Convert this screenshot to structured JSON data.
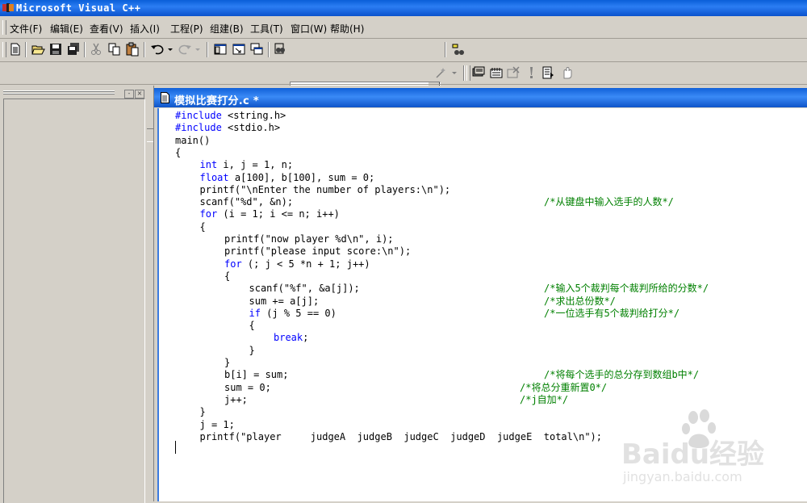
{
  "window": {
    "title": "Microsoft Visual C++"
  },
  "menu": [
    {
      "label": "文件(F)"
    },
    {
      "label": "编辑(E)"
    },
    {
      "label": "查看(V)"
    },
    {
      "label": "插入(I)"
    },
    {
      "label": "工程(P)"
    },
    {
      "label": "组建(B)"
    },
    {
      "label": "工具(T)"
    },
    {
      "label": "窗口(W)"
    },
    {
      "label": "帮助(H)"
    }
  ],
  "toolbar": {
    "find_combo_value": "",
    "icons": [
      "new-file-icon",
      "open-icon",
      "save-icon",
      "save-all-icon",
      "cut-icon",
      "copy-icon",
      "paste-icon",
      "undo-icon",
      "redo-icon",
      "workspace-icon",
      "output-icon",
      "window-list-icon",
      "find-in-files-icon",
      "find-icon"
    ]
  },
  "wizardbar": {
    "class_combo": "",
    "filter_combo": "",
    "members_combo": "",
    "icons": [
      "wizard-action-icon",
      "compile-icon",
      "build-icon",
      "stop-build-icon",
      "execute-icon",
      "go-icon",
      "insert-breakpoint-icon"
    ]
  },
  "editor": {
    "tab_title": "模拟比赛打分.c *",
    "lines": [
      {
        "indent": 0,
        "parts": [
          {
            "t": "#include",
            "k": "kw"
          },
          {
            "t": " <string.h>"
          }
        ]
      },
      {
        "indent": 0,
        "parts": [
          {
            "t": "#include",
            "k": "kw"
          },
          {
            "t": " <stdio.h>"
          }
        ]
      },
      {
        "indent": 0,
        "parts": [
          {
            "t": "main()"
          }
        ]
      },
      {
        "indent": 0,
        "parts": [
          {
            "t": "{"
          }
        ]
      },
      {
        "indent": 1,
        "parts": [
          {
            "t": "int",
            "k": "kw"
          },
          {
            "t": " i, j = 1, n;"
          }
        ]
      },
      {
        "indent": 1,
        "parts": [
          {
            "t": "float",
            "k": "kw"
          },
          {
            "t": " a[100], b[100], sum = 0;"
          }
        ]
      },
      {
        "indent": 1,
        "parts": [
          {
            "t": "printf(\"\\nEnter the number of players:\\n\");"
          }
        ]
      },
      {
        "indent": 1,
        "parts": [
          {
            "t": "scanf(\"%d\", &n);"
          }
        ],
        "comment": "/*从键盘中输入选手的人数*/",
        "ccol": "c1"
      },
      {
        "indent": 1,
        "parts": [
          {
            "t": "for",
            "k": "kw"
          },
          {
            "t": " (i = 1; i <= n; i++)"
          }
        ]
      },
      {
        "indent": 1,
        "parts": [
          {
            "t": "{"
          }
        ]
      },
      {
        "indent": 2,
        "parts": [
          {
            "t": "printf(\"now player %d\\n\", i);"
          }
        ]
      },
      {
        "indent": 2,
        "parts": [
          {
            "t": "printf(\"please input score:\\n\");"
          }
        ]
      },
      {
        "indent": 2,
        "parts": [
          {
            "t": "for",
            "k": "kw"
          },
          {
            "t": " (; j < 5 *n + 1; j++)"
          }
        ]
      },
      {
        "indent": 2,
        "parts": [
          {
            "t": "{"
          }
        ]
      },
      {
        "indent": 3,
        "parts": [
          {
            "t": "scanf(\"%f\", &a[j]);"
          }
        ],
        "comment": "/*输入5个裁判每个裁判所给的分数*/",
        "ccol": "c1"
      },
      {
        "indent": 3,
        "parts": [
          {
            "t": "sum += a[j];"
          }
        ],
        "comment": "/*求出总份数*/",
        "ccol": "c1"
      },
      {
        "indent": 3,
        "parts": [
          {
            "t": "if",
            "k": "kw"
          },
          {
            "t": " (j % 5 == 0)"
          }
        ],
        "comment": "/*一位选手有5个裁判给打分*/",
        "ccol": "c1"
      },
      {
        "indent": 3,
        "parts": [
          {
            "t": "{"
          }
        ]
      },
      {
        "indent": 4,
        "parts": [
          {
            "t": "break",
            "k": "kw"
          },
          {
            "t": ";"
          }
        ]
      },
      {
        "indent": 3,
        "parts": [
          {
            "t": "}"
          }
        ]
      },
      {
        "indent": 2,
        "parts": [
          {
            "t": "}"
          }
        ]
      },
      {
        "indent": 2,
        "parts": [
          {
            "t": "b[i] = sum;"
          }
        ],
        "comment": "/*将每个选手的总分存到数组b中*/",
        "ccol": "c1"
      },
      {
        "indent": 2,
        "parts": [
          {
            "t": "sum = 0;"
          }
        ],
        "comment": "/*将总分重新置0*/",
        "ccol": "c2"
      },
      {
        "indent": 2,
        "parts": [
          {
            "t": "j++;"
          }
        ],
        "comment": "/*j自加*/",
        "ccol": "c2"
      },
      {
        "indent": 1,
        "parts": [
          {
            "t": "}"
          }
        ]
      },
      {
        "indent": 1,
        "parts": [
          {
            "t": "j = 1;"
          }
        ]
      },
      {
        "indent": 1,
        "parts": [
          {
            "t": "printf(\"player     judgeA  judgeB  judgeC  judgeD  judgeE  total\\n\");"
          }
        ]
      },
      {
        "indent": 0,
        "parts": [
          {
            "t": ""
          }
        ]
      }
    ]
  },
  "watermark": {
    "brand": "Baidu经验",
    "url": "jingyan.baidu.com"
  },
  "colors": {
    "keyword": "#0000ff",
    "comment": "#008000",
    "titlebar": "#0a5fd8"
  }
}
